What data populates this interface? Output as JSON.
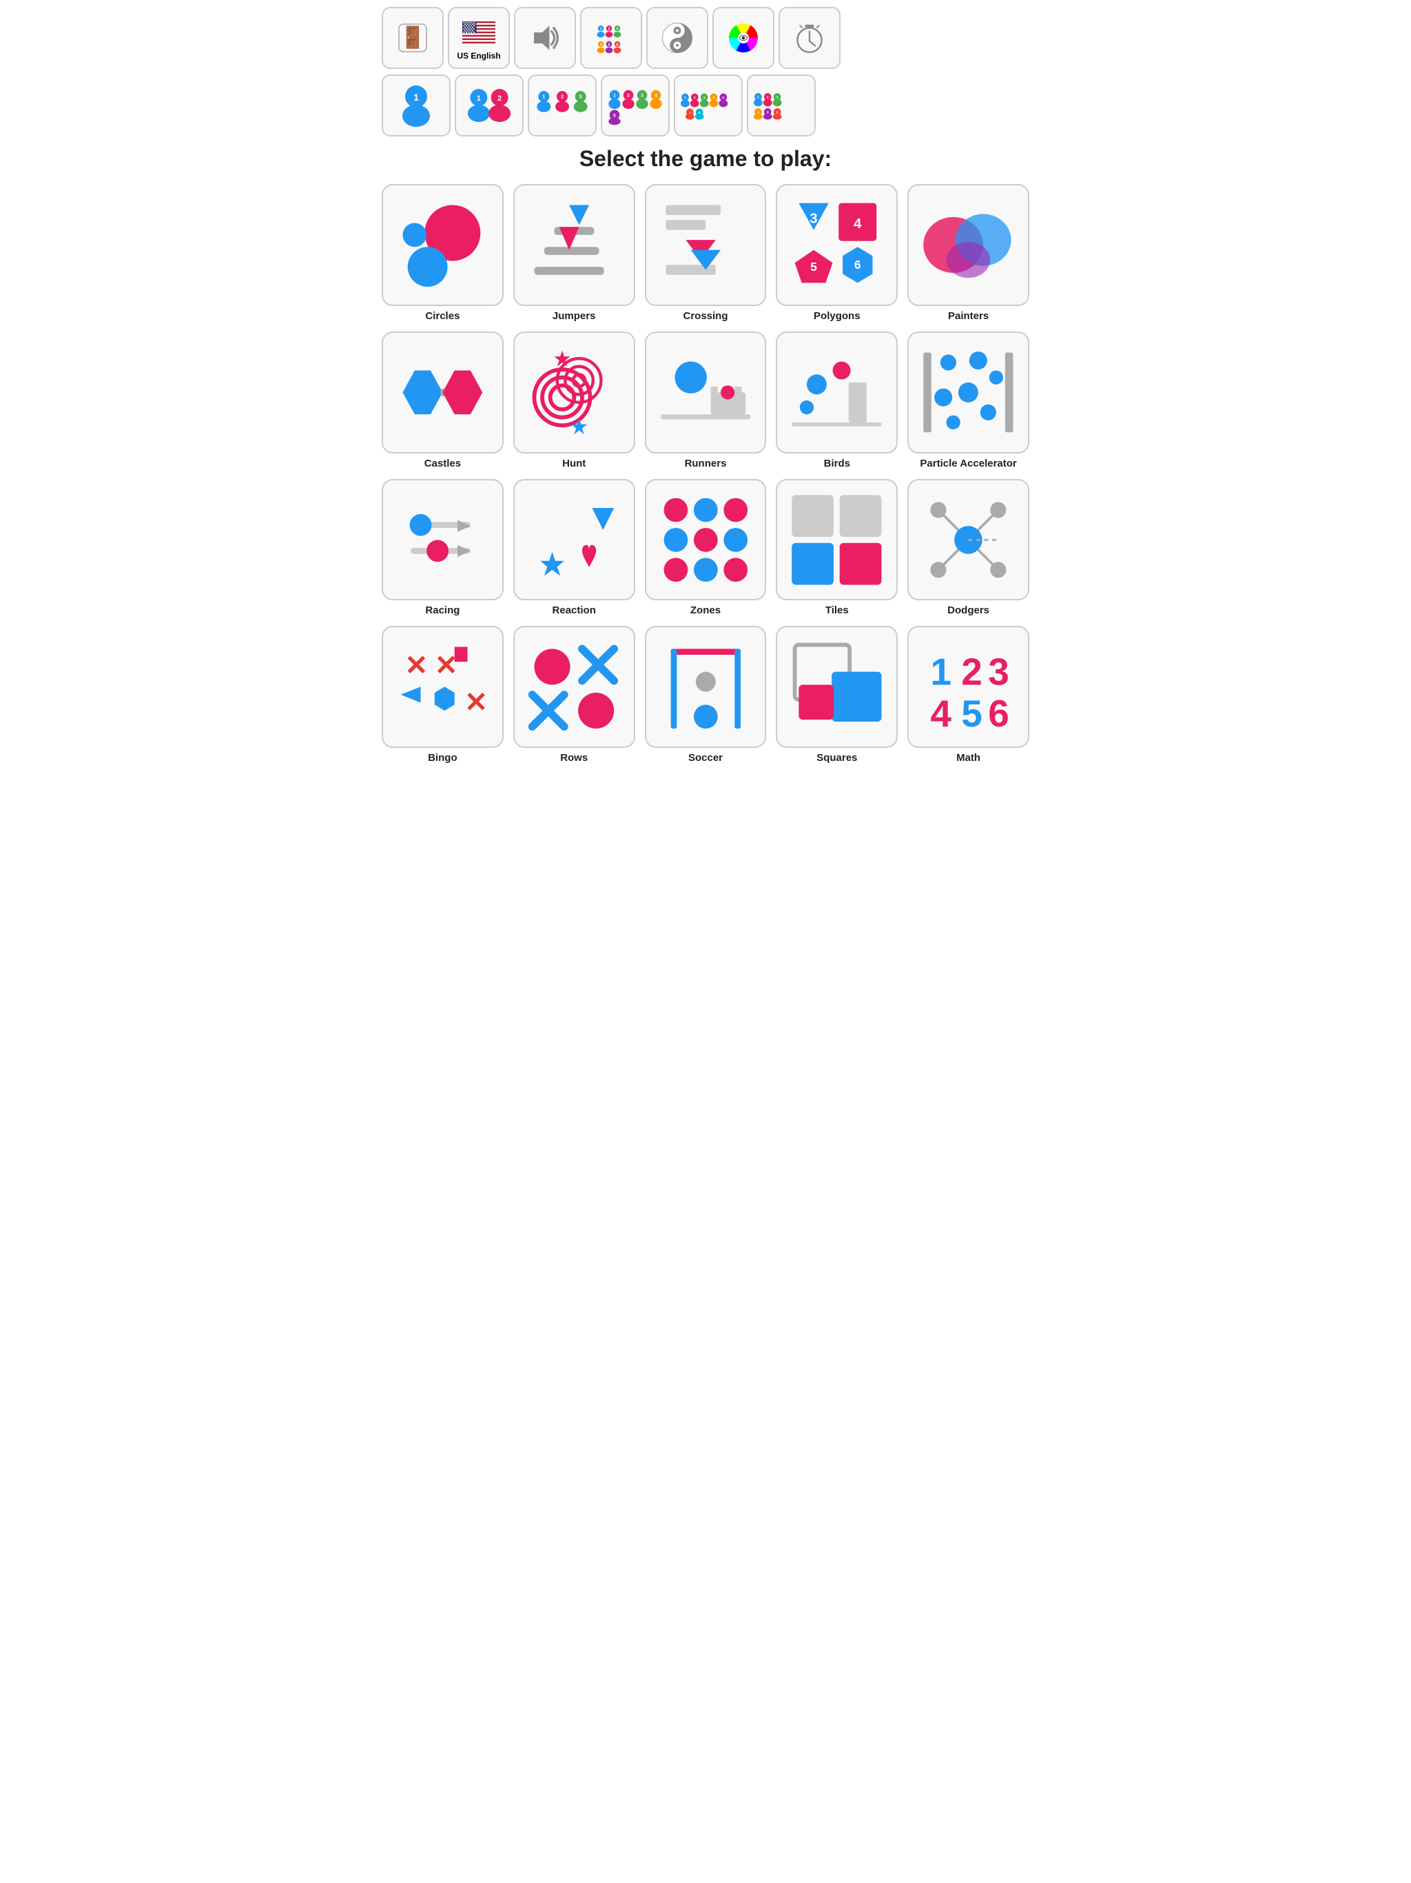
{
  "toolbar": {
    "items": [
      {
        "name": "exit-button",
        "label": ""
      },
      {
        "name": "language-button",
        "label": "US English"
      },
      {
        "name": "sound-button",
        "label": ""
      },
      {
        "name": "players-button",
        "label": ""
      },
      {
        "name": "yinyang-button",
        "label": ""
      },
      {
        "name": "colorwheel-button",
        "label": ""
      },
      {
        "name": "timer-button",
        "label": ""
      }
    ]
  },
  "players": {
    "options": [
      1,
      2,
      3,
      4,
      5,
      6
    ]
  },
  "title": "Select the game to play:",
  "games": [
    {
      "id": "circles",
      "label": "Circles"
    },
    {
      "id": "jumpers",
      "label": "Jumpers"
    },
    {
      "id": "crossing",
      "label": "Crossing"
    },
    {
      "id": "polygons",
      "label": "Polygons"
    },
    {
      "id": "painters",
      "label": "Painters"
    },
    {
      "id": "castles",
      "label": "Castles"
    },
    {
      "id": "hunt",
      "label": "Hunt"
    },
    {
      "id": "runners",
      "label": "Runners"
    },
    {
      "id": "birds",
      "label": "Birds"
    },
    {
      "id": "particle-accelerator",
      "label": "Particle Accelerator"
    },
    {
      "id": "racing",
      "label": "Racing"
    },
    {
      "id": "reaction",
      "label": "Reaction"
    },
    {
      "id": "zones",
      "label": "Zones"
    },
    {
      "id": "tiles",
      "label": "Tiles"
    },
    {
      "id": "dodgers",
      "label": "Dodgers"
    },
    {
      "id": "bingo",
      "label": "Bingo"
    },
    {
      "id": "rows",
      "label": "Rows"
    },
    {
      "id": "soccer",
      "label": "Soccer"
    },
    {
      "id": "squares",
      "label": "Squares"
    },
    {
      "id": "math",
      "label": "Math"
    }
  ]
}
